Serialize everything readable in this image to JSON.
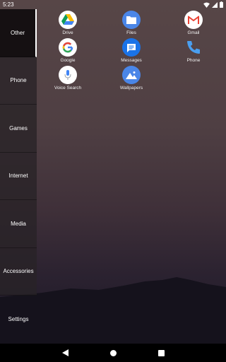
{
  "status_bar": {
    "time": "5:23",
    "icons": [
      "wifi-icon",
      "signal-icon",
      "battery-icon"
    ]
  },
  "sidebar": {
    "items": [
      {
        "label": "Other",
        "active": true
      },
      {
        "label": "Phone",
        "active": false
      },
      {
        "label": "Games",
        "active": false
      },
      {
        "label": "Internet",
        "active": false
      },
      {
        "label": "Media",
        "active": false
      },
      {
        "label": "Accessories",
        "active": false
      },
      {
        "label": "Settings",
        "active": false
      }
    ]
  },
  "apps": [
    {
      "label": "Drive",
      "icon": "google-drive-icon"
    },
    {
      "label": "Files",
      "icon": "files-folder-icon"
    },
    {
      "label": "Gmail",
      "icon": "gmail-icon"
    },
    {
      "label": "Google",
      "icon": "google-g-icon"
    },
    {
      "label": "Messages",
      "icon": "messages-icon"
    },
    {
      "label": "Phone",
      "icon": "phone-icon"
    },
    {
      "label": "Voice Search",
      "icon": "microphone-icon"
    },
    {
      "label": "Wallpapers",
      "icon": "wallpapers-icon"
    }
  ],
  "nav_bar": {
    "buttons": [
      "back-icon",
      "home-icon",
      "recents-icon"
    ]
  },
  "colors": {
    "accent_blue": "#4a86e8",
    "sidebar_active_bg": "#151012",
    "sidebar_bg": "#282226"
  }
}
